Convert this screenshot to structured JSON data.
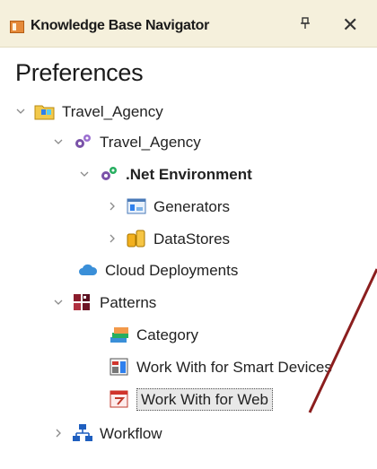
{
  "panel": {
    "title": "Knowledge Base Navigator",
    "pin_glyph": "↕",
    "close_glyph": "✕"
  },
  "heading": "Preferences",
  "tree": [
    {
      "label": "Travel_Agency",
      "icon": "kb-folder-icon",
      "expander": "expanded"
    },
    {
      "label": "Travel_Agency",
      "icon": "gears-icon",
      "expander": "expanded"
    },
    {
      "label": ".Net Environment",
      "icon": "gears-green-icon",
      "expander": "expanded",
      "bold": true
    },
    {
      "label": "Generators",
      "icon": "generator-icon",
      "expander": "collapsed"
    },
    {
      "label": "DataStores",
      "icon": "datastore-icon",
      "expander": "collapsed"
    },
    {
      "label": "Cloud Deployments",
      "icon": "cloud-icon",
      "expander": "none"
    },
    {
      "label": "Patterns",
      "icon": "patterns-icon",
      "expander": "expanded"
    },
    {
      "label": "Category",
      "icon": "category-icon",
      "expander": "none"
    },
    {
      "label": "Work With for Smart Devices",
      "icon": "smart-devices-icon",
      "expander": "none"
    },
    {
      "label": "Work With for Web",
      "icon": "web-pattern-icon",
      "expander": "none",
      "selected": true
    },
    {
      "label": "Workflow",
      "icon": "workflow-icon",
      "expander": "collapsed"
    }
  ],
  "colors": {
    "titlebar": "#f5f0dc",
    "annotation_arrow": "#8b1e1e"
  }
}
